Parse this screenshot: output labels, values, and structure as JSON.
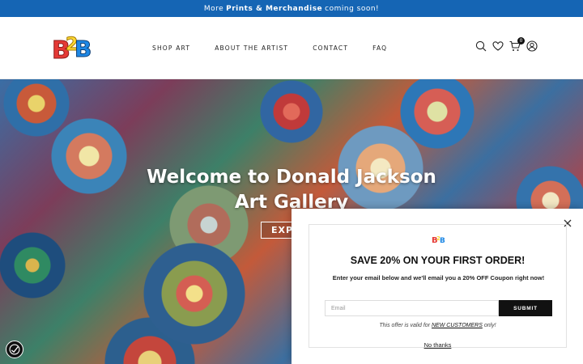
{
  "announcement": {
    "prefix": "More",
    "highlight": "Prints & Merchandise",
    "suffix": "coming soon!"
  },
  "header": {
    "logo_text": "B2B",
    "nav": [
      "SHOP ART",
      "ABOUT THE ARTIST",
      "CONTACT",
      "FAQ"
    ],
    "cart_count": "0",
    "icons": [
      "search-icon",
      "heart-icon",
      "cart-icon",
      "account-icon"
    ]
  },
  "hero": {
    "title": "Welcome to Donald Jackson Art Gallery",
    "button_label": "EXPL"
  },
  "popup": {
    "title": "SAVE 20% ON YOUR FIRST ORDER!",
    "subtitle": "Enter your email below and we'll email you a 20% OFF Coupon right now!",
    "email_placeholder": "Email",
    "submit_label": "SUBMIT",
    "offer_prefix": "This offer is valid for",
    "offer_highlight": "NEW CUSTOMERS",
    "offer_suffix": "only!",
    "decline_label": "No thanks"
  },
  "colors": {
    "announcement_bg": "#1565b4",
    "button_dark": "#111111"
  }
}
